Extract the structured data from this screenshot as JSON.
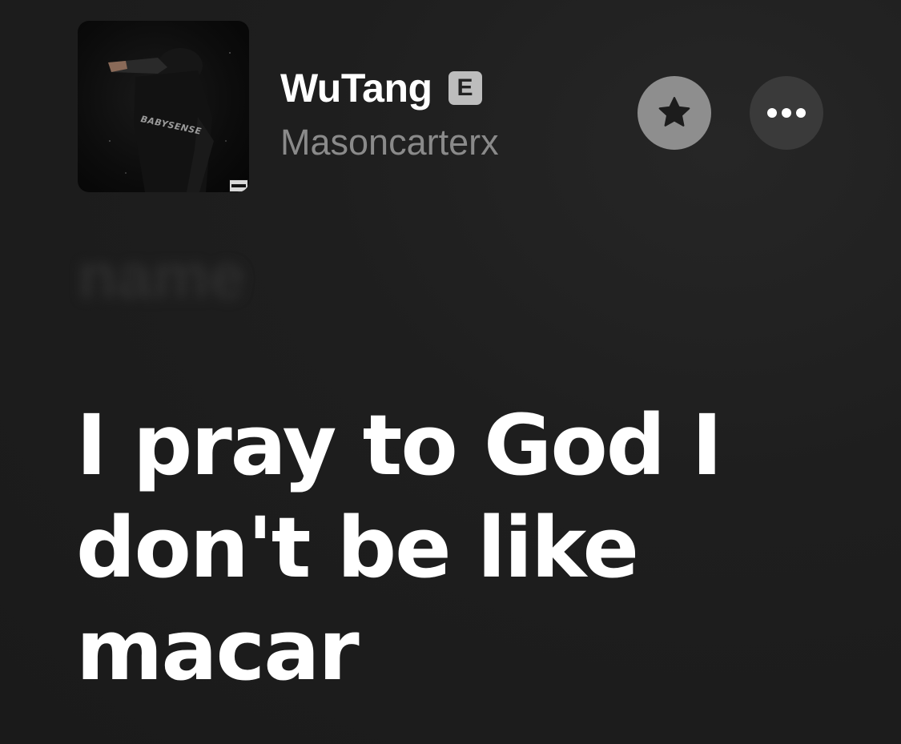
{
  "track": {
    "title": "WuTang",
    "explicit_label": "E",
    "artist": "Masoncarterx",
    "artwork_text": "BABYSENSE"
  },
  "actions": {
    "favorite_icon": "star-icon",
    "more_icon": "ellipsis-icon"
  },
  "lyrics": {
    "previous_line": "name",
    "current_line": "I pray to God I don't be like macar"
  },
  "colors": {
    "background": "#1e1e1e",
    "title": "#ffffff",
    "artist": "#8a8a8a",
    "favorite_button": "#8e8e8e",
    "more_button": "#3a3a3a"
  }
}
